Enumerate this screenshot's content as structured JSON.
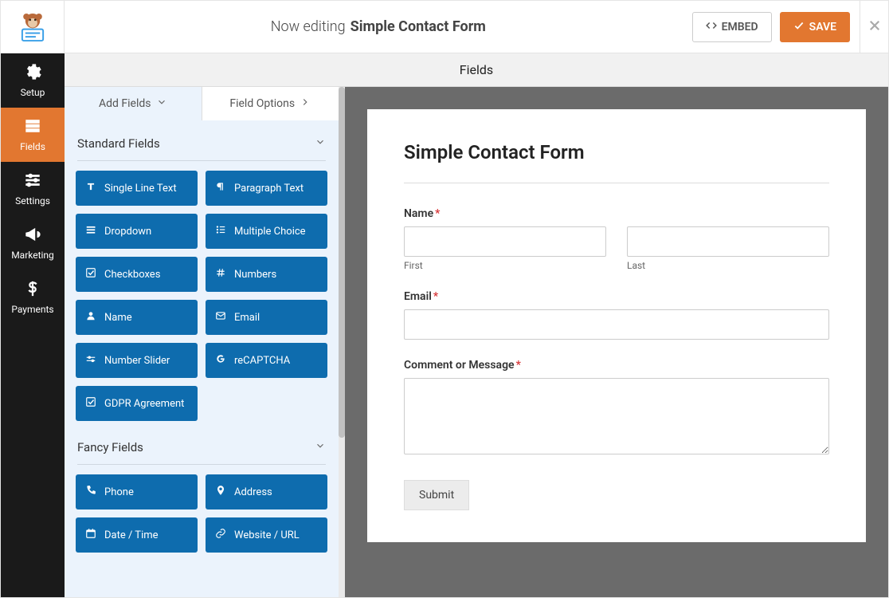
{
  "topbar": {
    "now_editing": "Now editing",
    "form_name": "Simple Contact Form",
    "embed_label": "EMBED",
    "save_label": "SAVE"
  },
  "sidebar": {
    "items": [
      {
        "label": "Setup"
      },
      {
        "label": "Fields"
      },
      {
        "label": "Settings"
      },
      {
        "label": "Marketing"
      },
      {
        "label": "Payments"
      }
    ],
    "active_index": 1
  },
  "content_title": "Fields",
  "panel": {
    "tabs": {
      "add_fields": "Add Fields",
      "field_options": "Field Options",
      "active": 0
    },
    "groups": [
      {
        "title": "Standard Fields",
        "expanded": true,
        "fields": [
          {
            "label": "Single Line Text",
            "icon": "text"
          },
          {
            "label": "Paragraph Text",
            "icon": "paragraph"
          },
          {
            "label": "Dropdown",
            "icon": "dropdown"
          },
          {
            "label": "Multiple Choice",
            "icon": "list"
          },
          {
            "label": "Checkboxes",
            "icon": "check"
          },
          {
            "label": "Numbers",
            "icon": "hash"
          },
          {
            "label": "Name",
            "icon": "user"
          },
          {
            "label": "Email",
            "icon": "mail"
          },
          {
            "label": "Number Slider",
            "icon": "slider"
          },
          {
            "label": "reCAPTCHA",
            "icon": "google"
          },
          {
            "label": "GDPR Agreement",
            "icon": "check"
          }
        ]
      },
      {
        "title": "Fancy Fields",
        "expanded": true,
        "fields": [
          {
            "label": "Phone",
            "icon": "phone"
          },
          {
            "label": "Address",
            "icon": "pin"
          },
          {
            "label": "Date / Time",
            "icon": "calendar"
          },
          {
            "label": "Website / URL",
            "icon": "link"
          }
        ]
      }
    ]
  },
  "form": {
    "title": "Simple Contact Form",
    "name_label": "Name",
    "first_sub": "First",
    "last_sub": "Last",
    "email_label": "Email",
    "comment_label": "Comment or Message",
    "submit_label": "Submit"
  },
  "colors": {
    "accent_orange": "#e27730",
    "accent_blue": "#0e6cae",
    "panel_bg": "#ebf3fc"
  }
}
